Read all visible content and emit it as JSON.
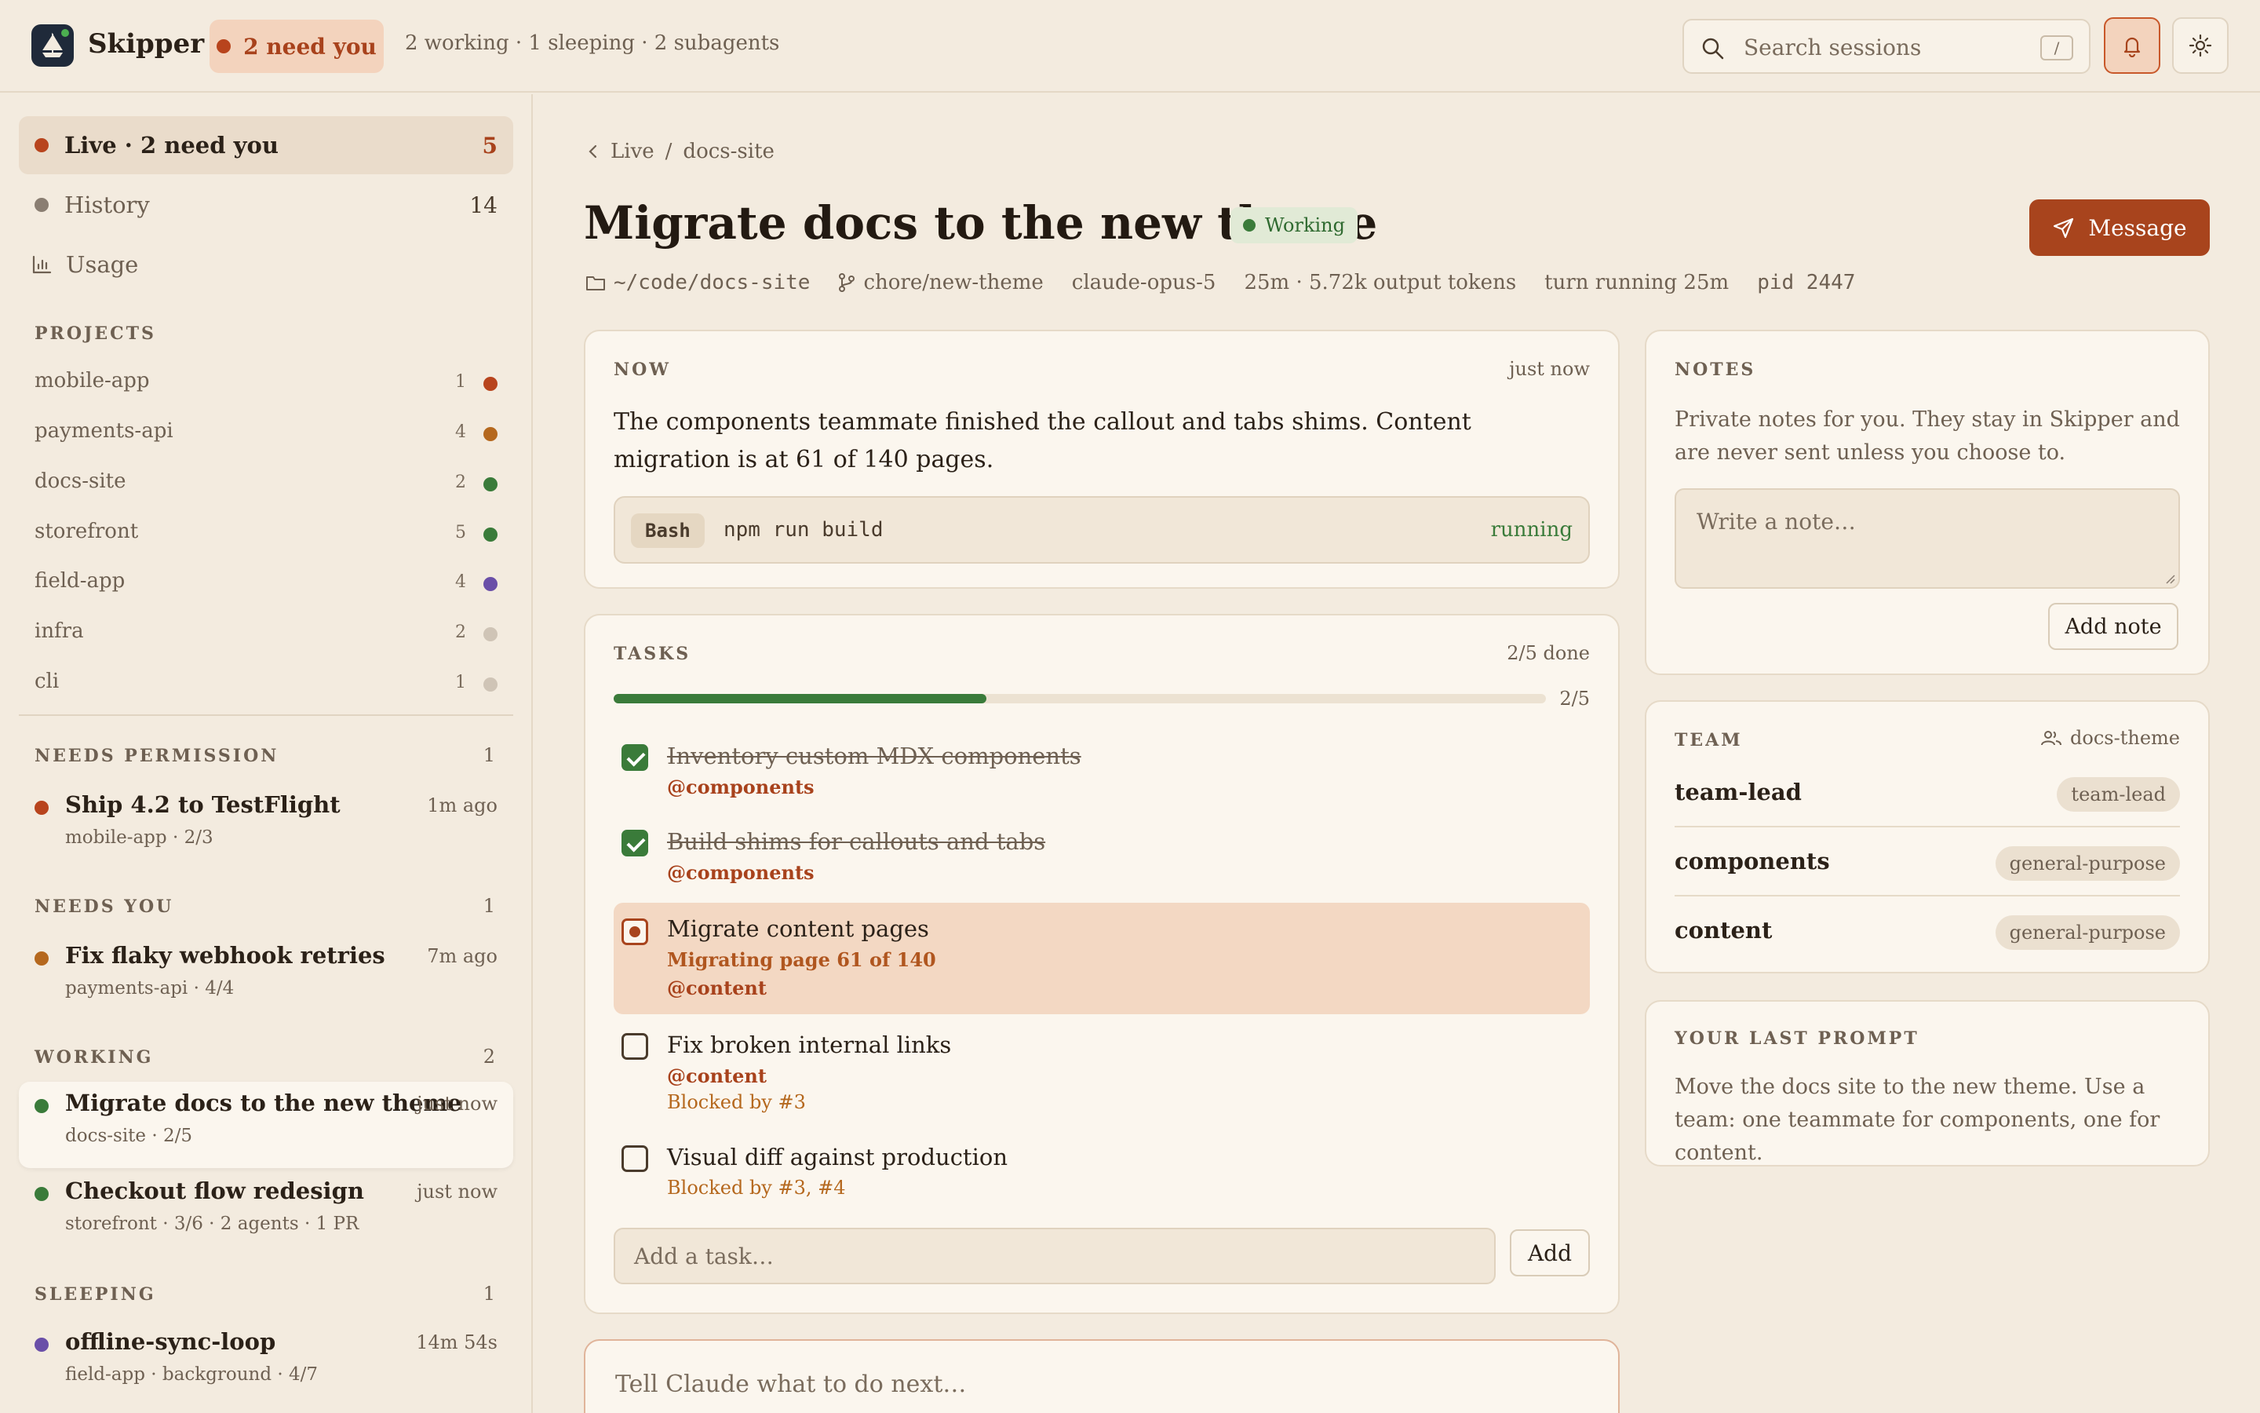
{
  "app": {
    "name": "Skipper",
    "need_you": "2 need you",
    "status_summary": "2 working · 1 sleeping · 2 subagents",
    "search_placeholder": "Search sessions",
    "search_shortcut": "/"
  },
  "sidebar": {
    "nav": [
      {
        "label": "Live · 2 need you",
        "count": "5",
        "color": "#b8441d"
      },
      {
        "label": "History",
        "count": "14",
        "color": "#8a7e72"
      },
      {
        "label": "Usage",
        "icon": "bar-chart-icon"
      }
    ],
    "projects_header": "PROJECTS",
    "projects": [
      {
        "name": "mobile-app",
        "count": "1",
        "color": "#b8441d"
      },
      {
        "name": "payments-api",
        "count": "4",
        "color": "#b5681e"
      },
      {
        "name": "docs-site",
        "count": "2",
        "color": "#3a7b3a"
      },
      {
        "name": "storefront",
        "count": "5",
        "color": "#3a7b3a"
      },
      {
        "name": "field-app",
        "count": "4",
        "color": "#6a4fa8"
      },
      {
        "name": "infra",
        "count": "2",
        "color": "#cfc4b6"
      },
      {
        "name": "cli",
        "count": "1",
        "color": "#cfc4b6"
      }
    ],
    "groups": [
      {
        "header": "NEEDS PERMISSION",
        "count": "1",
        "sessions": [
          {
            "title": "Ship 4.2 to TestFlight",
            "time": "1m ago",
            "sub": "mobile-app  · 2/3",
            "color": "#b8441d"
          }
        ]
      },
      {
        "header": "NEEDS YOU",
        "count": "1",
        "sessions": [
          {
            "title": "Fix flaky webhook retries",
            "time": "7m ago",
            "sub": "payments-api  · 4/4",
            "color": "#b5681e"
          }
        ]
      },
      {
        "header": "WORKING",
        "count": "2",
        "sessions": [
          {
            "title": "Migrate docs to the new theme",
            "time": "just now",
            "sub": "docs-site  · 2/5",
            "color": "#3a7b3a"
          },
          {
            "title": "Checkout flow redesign",
            "time": "just now",
            "sub": "storefront  · 3/6  · 2 agents  · 1 PR",
            "color": "#3a7b3a"
          }
        ]
      },
      {
        "header": "SLEEPING",
        "count": "1",
        "sessions": [
          {
            "title": "offline-sync-loop",
            "time": "14m 54s",
            "sub": "field-app  · background  · 4/7",
            "color": "#6a4fa8"
          }
        ]
      }
    ]
  },
  "main": {
    "breadcrumb": {
      "parent": "Live",
      "sep": "/",
      "current": "docs-site"
    },
    "title": "Migrate docs to the new theme",
    "status": "Working",
    "message_button": "Message",
    "meta": {
      "path": "~/code/docs-site",
      "branch": "chore/new-theme",
      "model": "claude-opus-5",
      "usage": "25m · 5.72k output tokens",
      "turn": "turn running 25m",
      "pid": "pid 2447"
    },
    "now": {
      "header": "NOW",
      "time": "just now",
      "text": "The components teammate finished the callout and tabs shims. Content migration is at 61 of 140 pages.",
      "tool": "Bash",
      "command": "npm run build",
      "command_status": "running"
    },
    "tasks": {
      "header": "TASKS",
      "done_label": "2/5 done",
      "progress_label": "2/5",
      "progress_fraction": 0.4,
      "items": [
        {
          "title": "Inventory custom MDX components",
          "owner": "@components",
          "state": "done"
        },
        {
          "title": "Build shims for callouts and tabs",
          "owner": "@components",
          "state": "done"
        },
        {
          "title": "Migrate content pages",
          "detail": "Migrating page 61 of 140",
          "owner": "@content",
          "state": "in_progress"
        },
        {
          "title": "Fix broken internal links",
          "owner": "@content",
          "blocked": "Blocked by #3",
          "state": "todo"
        },
        {
          "title": "Visual diff against production",
          "blocked": "Blocked by #3, #4",
          "state": "todo"
        }
      ],
      "add_placeholder": "Add a task…",
      "add_button": "Add"
    },
    "composer_placeholder": "Tell Claude what to do next…"
  },
  "right": {
    "notes": {
      "header": "NOTES",
      "desc": "Private notes for you. They stay in Skipper and are never sent unless you choose to.",
      "placeholder": "Write a note…",
      "button": "Add note"
    },
    "team": {
      "header": "TEAM",
      "name": "docs-theme",
      "members": [
        {
          "name": "team-lead",
          "role": "team-lead"
        },
        {
          "name": "components",
          "role": "general-purpose"
        },
        {
          "name": "content",
          "role": "general-purpose"
        }
      ]
    },
    "last_prompt": {
      "header": "YOUR LAST PROMPT",
      "text": "Move the docs site to the new theme. Use a team: one teammate for components, one for content."
    }
  }
}
